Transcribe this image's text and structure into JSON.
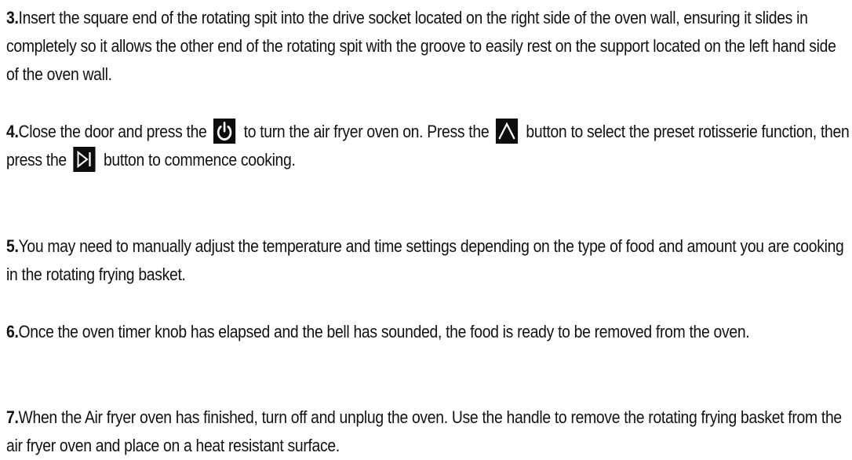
{
  "steps": [
    {
      "number": "3.",
      "text": "Insert the square end of the rotating spit into the drive socket located on the right side of the oven wall, ensuring it slides in completely so it allows the other end of the rotating spit with the groove to easily rest on the support located on the left hand side of the oven wall."
    },
    {
      "number": "4.",
      "text_a": "Close the door and press the ",
      "icon_1": "power-icon",
      "text_b": " to turn the air fryer oven on. Press the ",
      "icon_2": "triangle-up-icon",
      "text_c": " button to select the preset rotisserie function, then press the ",
      "icon_3": "play-pause-icon",
      "text_d": " button to commence cooking."
    },
    {
      "number": "5.",
      "text": "You may need to manually adjust the temperature and time settings depending on the type of food and amount you are cooking in the rotating frying basket."
    },
    {
      "number": "6.",
      "text": "Once the oven timer knob has elapsed and the bell has sounded, the food is ready to be removed from the oven."
    },
    {
      "number": "7.",
      "text": "When the Air fryer oven has finished, turn off and unplug the oven. Use the handle to remove the rotating frying basket from the air fryer oven and place on a heat resistant surface."
    }
  ],
  "colors": {
    "text": "#111111",
    "icon_background": "#0d0d0d",
    "icon_foreground": "#ffffff"
  }
}
